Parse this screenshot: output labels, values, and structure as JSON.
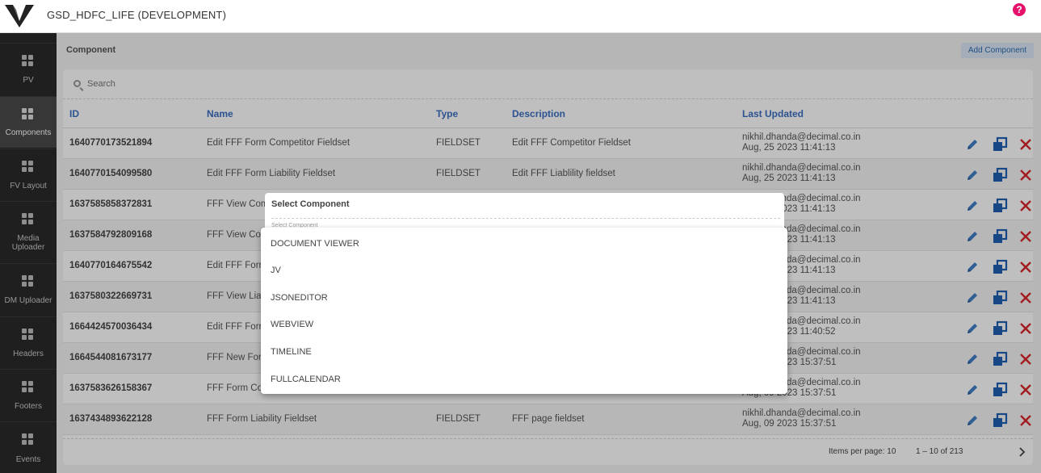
{
  "app": {
    "title": "GSD_HDFC_LIFE (DEVELOPMENT)",
    "help": "?"
  },
  "sidebar": {
    "items": [
      {
        "label": "PV"
      },
      {
        "label": "Components",
        "active": true
      },
      {
        "label": "FV Layout"
      },
      {
        "label_line1": "Media",
        "label_line2": "Uploader"
      },
      {
        "label": "DM Uploader"
      },
      {
        "label": "Headers"
      },
      {
        "label": "Footers"
      },
      {
        "label": "Events"
      }
    ]
  },
  "page": {
    "title": "Component",
    "add_button": "Add Component"
  },
  "search": {
    "placeholder": "Search"
  },
  "table": {
    "columns": [
      "ID",
      "Name",
      "Type",
      "Description",
      "Last Updated"
    ],
    "rows": [
      {
        "id": "1640770173521894",
        "name": "Edit FFF Form Competitor Fieldset",
        "type": "FIELDSET",
        "description": "Edit FFF Competitor Fieldset",
        "user": "nikhil.dhanda@decimal.co.in",
        "date": "Aug, 25 2023 11:41:13"
      },
      {
        "id": "1640770154099580",
        "name": "Edit FFF Form Liability Fieldset",
        "type": "FIELDSET",
        "description": "Edit FFF Liablility fieldset",
        "user": "nikhil.dhanda@decimal.co.in",
        "date": "Aug, 25 2023 11:41:13"
      },
      {
        "id": "1637585858372831",
        "name": "FFF View Com",
        "type": "",
        "description": "",
        "user": "nikhil.dhanda@decimal.co.in",
        "date": "Aug, 25 2023 11:41:13"
      },
      {
        "id": "1637584792809168",
        "name": "FFF View Co",
        "type": "",
        "description": "",
        "user": "nikhil.dhanda@decimal.co.in",
        "date": "Aug, 25 2023 11:41:13"
      },
      {
        "id": "1640770164675542",
        "name": "Edit FFF Forr",
        "type": "",
        "description": "",
        "user": "nikhil.dhanda@decimal.co.in",
        "date": "Aug, 25 2023 11:41:13"
      },
      {
        "id": "1637580322669731",
        "name": "FFF View Liab",
        "type": "",
        "description": "",
        "user": "nikhil.dhanda@decimal.co.in",
        "date": "Aug, 25 2023 11:41:13"
      },
      {
        "id": "1664424570036434",
        "name": "Edit FFF Forr",
        "type": "",
        "description": "",
        "user": "nikhil.dhanda@decimal.co.in",
        "date": "Aug, 25 2023 11:40:52"
      },
      {
        "id": "1664544081673177",
        "name": "FFF New For",
        "type": "",
        "description": "",
        "user": "nikhil.dhanda@decimal.co.in",
        "date": "Aug, 09 2023 15:37:51"
      },
      {
        "id": "1637583626158367",
        "name": "FFF Form Co",
        "type": "",
        "description": "",
        "user": "nikhil.dhanda@decimal.co.in",
        "date": "Aug, 09 2023 15:37:51"
      },
      {
        "id": "1637434893622128",
        "name": "FFF Form Liability Fieldset",
        "type": "FIELDSET",
        "description": "FFF page fieldset",
        "user": "nikhil.dhanda@decimal.co.in",
        "date": "Aug, 09 2023 15:37:51"
      }
    ]
  },
  "pagination": {
    "items_per_page": "Items per page: 10",
    "range": "1 – 10 of 213"
  },
  "modal": {
    "title": "Select Component",
    "placeholder": "Select Component",
    "options": [
      "DOCUMENT VIEWER",
      "JV",
      "JSONEDITOR",
      "WEBVIEW",
      "TIMELINE",
      "FULLCALENDAR"
    ]
  },
  "colors": {
    "accent": "#3b6fc2",
    "edit": "#3f7fc6",
    "copy": "#1f5fb0",
    "delete": "#d9262b",
    "help": "#e4126b",
    "sidebar": "#2a2a2a"
  }
}
